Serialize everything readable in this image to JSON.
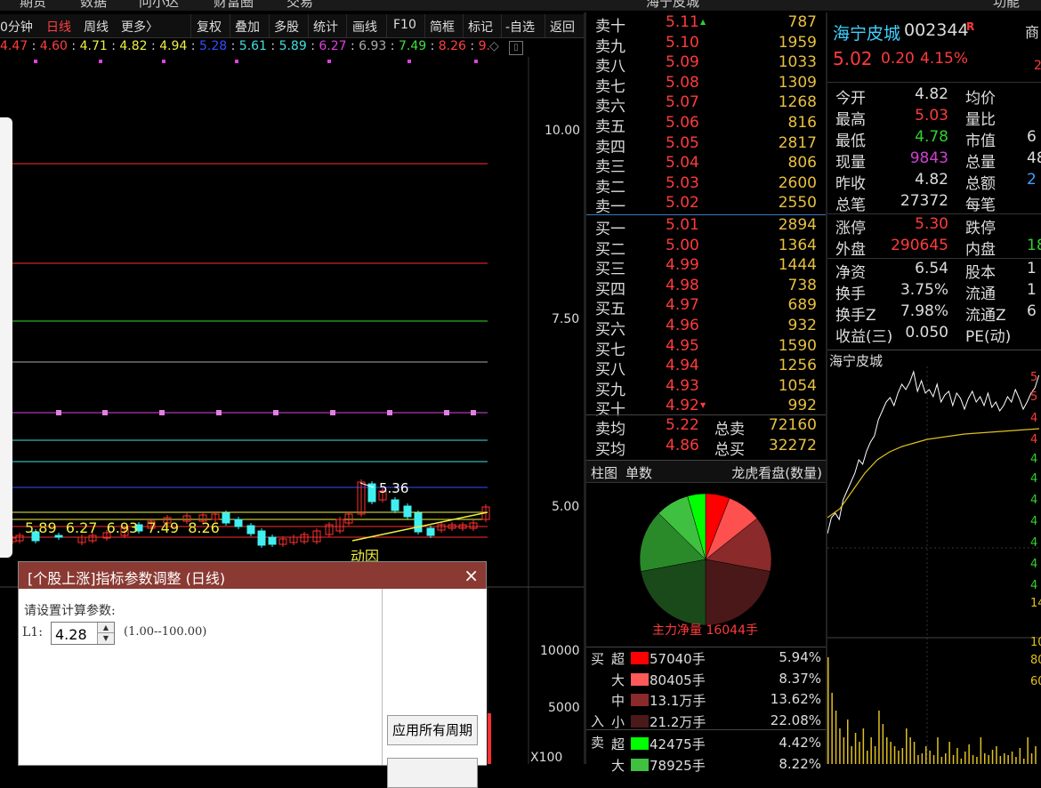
{
  "top_menu": [
    "期货",
    "数据",
    "问小达",
    "财富圈",
    "交易",
    "海宁皮城",
    "功能"
  ],
  "toolbar": {
    "period": "0分钟",
    "daily": "日线",
    "weekly": "周线",
    "more": "更多〉",
    "buttons": [
      "复权",
      "叠加",
      "多股",
      "统计",
      "画线",
      "F10",
      "简框",
      "标记",
      "-自选",
      "返回"
    ]
  },
  "ma_legend": [
    {
      "text": "4.47",
      "color": "#ff4040"
    },
    {
      "text": "4.60",
      "color": "#ff4040"
    },
    {
      "text": "4.71",
      "color": "#f0f040"
    },
    {
      "text": "4.82",
      "color": "#f0f040"
    },
    {
      "text": "4.94",
      "color": "#f0f040"
    },
    {
      "text": "5.28",
      "color": "#3050ff"
    },
    {
      "text": "5.61",
      "color": "#40e0e0"
    },
    {
      "text": "5.89",
      "color": "#40e0e0"
    },
    {
      "text": "6.27",
      "color": "#e040e0"
    },
    {
      "text": "6.93",
      "color": "#aaaaaa"
    },
    {
      "text": "7.49",
      "color": "#40e040"
    },
    {
      "text": "8.26",
      "color": "#ff4040"
    },
    {
      "text": "9.",
      "color": "#ff4040"
    }
  ],
  "ma_separator": ":",
  "chart": {
    "y_labels": [
      "10.00",
      "7.50",
      "5.00"
    ],
    "volume_labels": [
      "10000",
      "5000",
      "X100"
    ],
    "price_annotation": "5.36",
    "inline_labels": "5.89  6.27  6.93  7.49  8.26",
    "indicator_label": "动因",
    "colors": {
      "up": "#ff3030",
      "down": "#40f0f0"
    }
  },
  "dialog": {
    "title": "[个股上涨]指标参数调整 (日线)",
    "close": "×",
    "prompt": "请设置计算参数:",
    "param_label": "L1:",
    "param_value": "4.28",
    "param_range": "(1.00--100.00)",
    "apply_all": "应用所有周期"
  },
  "order_book": {
    "asks": [
      {
        "label": "卖十",
        "price": "5.11",
        "vol": "787",
        "mark": "up"
      },
      {
        "label": "卖九",
        "price": "5.10",
        "vol": "1959"
      },
      {
        "label": "卖八",
        "price": "5.09",
        "vol": "1033"
      },
      {
        "label": "卖七",
        "price": "5.08",
        "vol": "1309"
      },
      {
        "label": "卖六",
        "price": "5.07",
        "vol": "1268"
      },
      {
        "label": "卖五",
        "price": "5.06",
        "vol": "816"
      },
      {
        "label": "卖四",
        "price": "5.05",
        "vol": "2817"
      },
      {
        "label": "卖三",
        "price": "5.04",
        "vol": "806"
      },
      {
        "label": "卖二",
        "price": "5.03",
        "vol": "2600"
      },
      {
        "label": "卖一",
        "price": "5.02",
        "vol": "2550"
      }
    ],
    "bids": [
      {
        "label": "买一",
        "price": "5.01",
        "vol": "2894"
      },
      {
        "label": "买二",
        "price": "5.00",
        "vol": "1364"
      },
      {
        "label": "买三",
        "price": "4.99",
        "vol": "1444"
      },
      {
        "label": "买四",
        "price": "4.98",
        "vol": "738"
      },
      {
        "label": "买五",
        "price": "4.97",
        "vol": "689"
      },
      {
        "label": "买六",
        "price": "4.96",
        "vol": "932"
      },
      {
        "label": "买七",
        "price": "4.95",
        "vol": "1590"
      },
      {
        "label": "买八",
        "price": "4.94",
        "vol": "1256"
      },
      {
        "label": "买九",
        "price": "4.93",
        "vol": "1054"
      },
      {
        "label": "买十",
        "price": "4.92",
        "vol": "992",
        "mark": "down"
      }
    ],
    "avg_sell_label": "卖均",
    "avg_sell": "5.22",
    "total_sell_label": "总卖",
    "total_sell": "72160",
    "avg_buy_label": "买均",
    "avg_buy": "4.86",
    "total_buy_label": "总买",
    "total_buy": "32272"
  },
  "flow": {
    "tab_bar": "柱图",
    "tab_count": "单数",
    "title": "龙虎看盘(数量)",
    "net_label": "主力净量 16044手",
    "buy_label": "买",
    "in_label": "入",
    "sell_label": "卖",
    "rows": [
      {
        "side": "超",
        "color": "#ff0000",
        "vol": "57040手",
        "pct": "5.94%"
      },
      {
        "side": "大",
        "color": "#ff5a5a",
        "vol": "80405手",
        "pct": "8.37%"
      },
      {
        "side": "中",
        "color": "#8a2a2a",
        "vol": "13.1万手",
        "pct": "13.62%"
      },
      {
        "side": "小",
        "color": "#4a1a1a",
        "vol": "21.2万手",
        "pct": "22.08%"
      },
      {
        "side": "超",
        "color": "#00ff00",
        "vol": "42475手",
        "pct": "4.42%"
      },
      {
        "side": "大",
        "color": "#40c040",
        "vol": "78925手",
        "pct": "8.22%"
      }
    ],
    "pie_slices": [
      {
        "pct": 5.94,
        "color": "#ff0000"
      },
      {
        "pct": 8.37,
        "color": "#ff5050"
      },
      {
        "pct": 13.62,
        "color": "#8a2a2a"
      },
      {
        "pct": 22.08,
        "color": "#4a1818"
      },
      {
        "pct": 22.08,
        "color": "#1a4a1a"
      },
      {
        "pct": 15.3,
        "color": "#2a8a2a"
      },
      {
        "pct": 8.22,
        "color": "#40c040"
      },
      {
        "pct": 4.42,
        "color": "#00ff00"
      }
    ]
  },
  "quote": {
    "name": "海宁皮城",
    "code": "002344",
    "flag": "R",
    "right_cut": "商",
    "price": "5.02",
    "change": "0.20",
    "pct": "4.15%",
    "right_cut2": "2"
  },
  "stats": [
    {
      "k": "今开",
      "v": "4.82",
      "vc": "#dddddd",
      "k2": "均价",
      "v2": ""
    },
    {
      "k": "最高",
      "v": "5.03",
      "vc": "#ff3b3b",
      "k2": "量比",
      "v2": ""
    },
    {
      "k": "最低",
      "v": "4.78",
      "vc": "#30d030",
      "k2": "市值",
      "v2": "6"
    },
    {
      "k": "现量",
      "v": "9843",
      "vc": "#d040d0",
      "k2": "总量",
      "v2": "48"
    },
    {
      "k": "昨收",
      "v": "4.82",
      "vc": "#dddddd",
      "k2": "总额",
      "v2": "2"
    },
    {
      "k": "总笔",
      "v": "27372",
      "vc": "#dddddd",
      "k2": "每笔",
      "v2": ""
    },
    {
      "k": "涨停",
      "v": "5.30",
      "vc": "#ff3b3b",
      "k2": "跌停",
      "v2": ""
    },
    {
      "k": "外盘",
      "v": "290645",
      "vc": "#ff3b3b",
      "k2": "内盘",
      "v2": "18"
    },
    {
      "k": "净资",
      "v": "6.54",
      "vc": "#dddddd",
      "k2": "股本",
      "v2": "1"
    },
    {
      "k": "换手",
      "v": "3.75%",
      "vc": "#dddddd",
      "k2": "流通",
      "v2": "1"
    },
    {
      "k": "换手Z",
      "v": "7.98%",
      "vc": "#dddddd",
      "k2": "流通Z",
      "v2": "6"
    },
    {
      "k": "收益(三)",
      "v": "0.050",
      "vc": "#dddddd",
      "k2": "PE(动)",
      "v2": ""
    }
  ],
  "intraday": {
    "title": "海宁皮城",
    "right_labels": [
      "5",
      "5",
      "4",
      "4",
      "4",
      "4",
      "4",
      "4",
      "4",
      "4",
      "4",
      "14",
      "10",
      "80",
      "60"
    ]
  }
}
